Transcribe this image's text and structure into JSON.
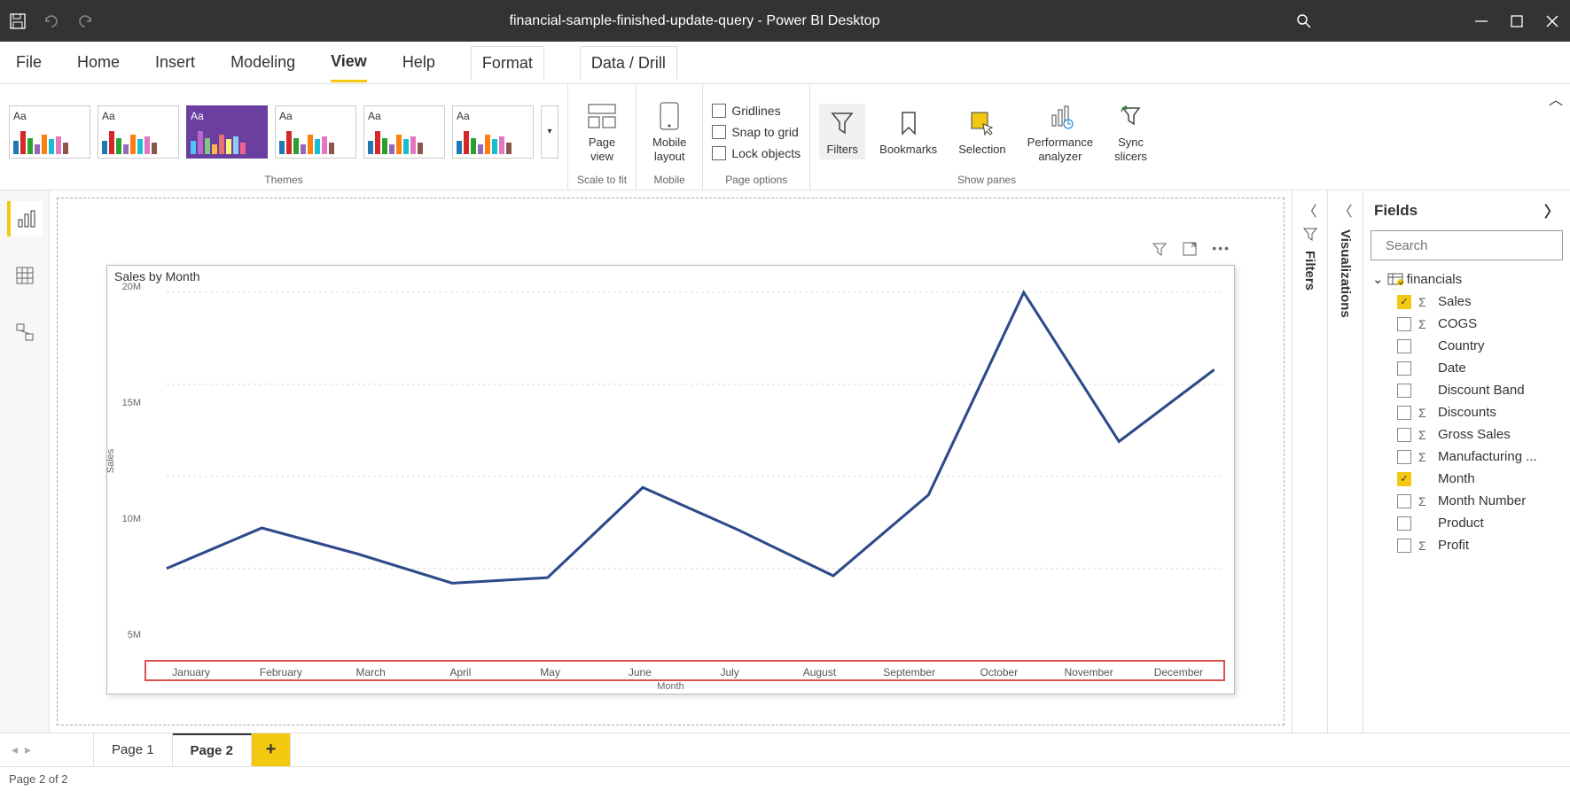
{
  "titlebar": {
    "title": "financial-sample-finished-update-query - Power BI Desktop"
  },
  "menu": {
    "file": "File",
    "home": "Home",
    "insert": "Insert",
    "modeling": "Modeling",
    "view": "View",
    "help": "Help",
    "format": "Format",
    "datadrill": "Data / Drill"
  },
  "ribbon": {
    "themes_label": "Themes",
    "scale_label": "Scale to fit",
    "mobile_label": "Mobile",
    "page_options_label": "Page options",
    "show_panes_label": "Show panes",
    "page_view": "Page\nview",
    "mobile_layout": "Mobile\nlayout",
    "gridlines": "Gridlines",
    "snap": "Snap to grid",
    "lock": "Lock objects",
    "filters": "Filters",
    "bookmarks": "Bookmarks",
    "selection": "Selection",
    "perf": "Performance\nanalyzer",
    "sync": "Sync\nslicers"
  },
  "panes": {
    "filters": "Filters",
    "visualizations": "Visualizations",
    "fields": "Fields",
    "search_ph": "Search"
  },
  "fields": {
    "table": "financials",
    "items": [
      {
        "label": "Sales",
        "checked": true,
        "sigma": true
      },
      {
        "label": "COGS",
        "checked": false,
        "sigma": true
      },
      {
        "label": "Country",
        "checked": false,
        "sigma": false
      },
      {
        "label": "Date",
        "checked": false,
        "sigma": false
      },
      {
        "label": "Discount Band",
        "checked": false,
        "sigma": false
      },
      {
        "label": "Discounts",
        "checked": false,
        "sigma": true
      },
      {
        "label": "Gross Sales",
        "checked": false,
        "sigma": true
      },
      {
        "label": "Manufacturing ...",
        "checked": false,
        "sigma": true
      },
      {
        "label": "Month",
        "checked": true,
        "sigma": false
      },
      {
        "label": "Month Number",
        "checked": false,
        "sigma": true
      },
      {
        "label": "Product",
        "checked": false,
        "sigma": false
      },
      {
        "label": "Profit",
        "checked": false,
        "sigma": true
      }
    ]
  },
  "tabs": {
    "page1": "Page 1",
    "page2": "Page 2"
  },
  "status": {
    "text": "Page 2 of 2"
  },
  "chart_data": {
    "type": "line",
    "title": "Sales by Month",
    "xlabel": "Month",
    "ylabel": "Sales",
    "categories": [
      "January",
      "February",
      "March",
      "April",
      "May",
      "June",
      "July",
      "August",
      "September",
      "October",
      "November",
      "December"
    ],
    "values": [
      5.0,
      7.2,
      5.8,
      4.2,
      4.5,
      9.4,
      7.1,
      4.6,
      9.0,
      20.0,
      11.9,
      15.8
    ],
    "yticks": [
      "5M",
      "10M",
      "15M",
      "20M"
    ],
    "ylim": [
      4,
      20
    ]
  }
}
